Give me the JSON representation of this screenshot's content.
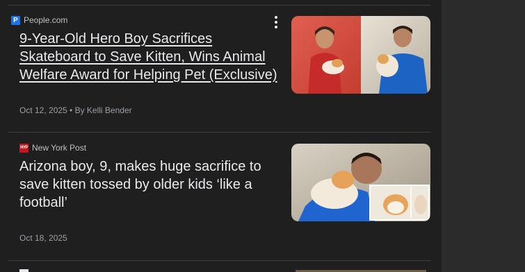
{
  "articles": [
    {
      "source": "People.com",
      "source_icon": "people-favicon-icon",
      "headline": "9-Year-Old Hero Boy Sacrifices Skateboard to Save Kitten, Wins Animal Welfare Award for Helping Pet (Exclusive)",
      "meta": "Oct 12, 2025 • By Kelli Bender"
    },
    {
      "source": "New York Post",
      "source_icon": "nypost-favicon-icon",
      "headline": "Arizona boy, 9, makes huge sacrifice to save kitten tossed by older kids ‘like a football’",
      "meta": "Oct 18, 2025"
    }
  ],
  "colors": {
    "background": "#1f1f1f",
    "right_panel": "#2b2b2c",
    "headline": "#e8eaed",
    "meta": "#9aa0a6",
    "divider": "#3c4043"
  }
}
